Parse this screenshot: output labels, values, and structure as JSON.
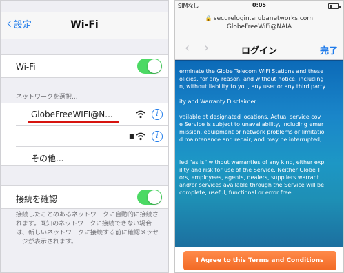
{
  "left_screen": {
    "nav": {
      "back_label": "設定",
      "title": "Wi-Fi"
    },
    "wifi_toggle": {
      "label": "Wi-Fi",
      "on": true
    },
    "network_section_header": "ネットワークを選択...",
    "networks": [
      {
        "name": "GlobeFreeWIFI@N...",
        "secured": false
      },
      {
        "name": "",
        "secured": true
      }
    ],
    "other_label": "その他...",
    "ask_to_join": {
      "label": "接続を確認",
      "on": true
    },
    "footnote": "接続したことのあるネットワークに自動的に接続されます。既知のネットワークに接続できない場合は、新しいネットワークに接続する前に確認メッセージが表示されます。",
    "colors": {
      "accent": "#1f7bea",
      "toggle_on": "#4cd964",
      "highlight": "#d7140f"
    }
  },
  "right_screen": {
    "status": {
      "carrier": "SIMなし",
      "time": "0:05",
      "battery_level": 0.3
    },
    "url_line1": "securelogin.arubanetworks.com",
    "url_line2": "GlobeFreeWiFi@NAIA",
    "title": "ログイン",
    "done_label": "完了",
    "terms_lines": [
      "erminate the Globe Telecom WiFi Stations and these",
      "olicies, for any reason, and without notice, including",
      "n, without liability to you, any user or any third party.",
      "ity and Warranty Disclaimer",
      "vailable at designated locations.  Actual service cov",
      "e Service is subject to unavailability, including emer",
      "mission, equipment or network problems or limitatio",
      "d maintenance and repair, and may be interrupted,",
      "led \"as is\" without warranties of any kind, either exp",
      "ility and risk for use of the Service. Neither Globe T",
      "ors, employees, agents, dealers, suppliers warrant",
      "and/or services available through the Service will be",
      "complete, useful, functional or error free."
    ],
    "agree_label": "I Agree to this Terms and Conditions",
    "colors": {
      "agree_button": "#f26a25",
      "accent": "#1f7bea"
    }
  }
}
